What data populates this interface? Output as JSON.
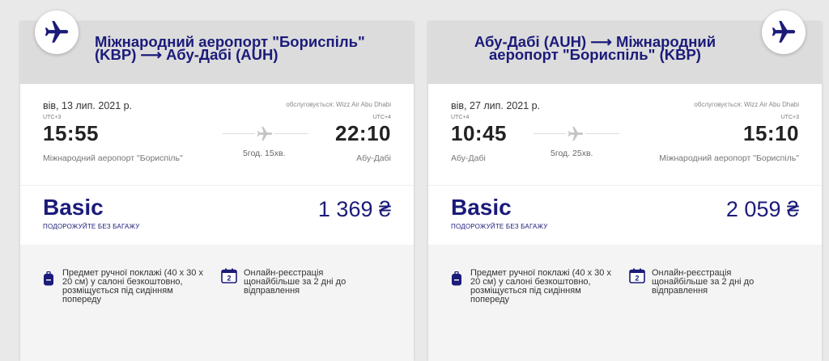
{
  "cards": [
    {
      "route_title": "Міжнародний аеропорт \"Бориспіль\" (KBP) ⟶ Абу-Дабі (AUH)",
      "date": "вів, 13 лип. 2021 р.",
      "operator": "обслуговується: Wizz Air Abu Dhabi",
      "dep_utc": "UTC+3",
      "dep_time": "15:55",
      "dep_airport": "Міжнародний аеропорт \"Бориспіль\"",
      "arr_utc": "UTC+4",
      "arr_time": "22:10",
      "arr_airport": "Абу-Дабі",
      "duration": "5год. 15хв.",
      "fare_name": "Basic",
      "fare_subtitle": "ПОДОРОЖУЙТЕ БЕЗ БАГАЖУ",
      "price": "1 369 ₴",
      "feature_bag": "Предмет ручної поклажі (40 x 30 x 20 см) у салоні безкоштовно, розміщується під сидінням попереду",
      "feature_checkin": "Онлайн-реєстрація щонайбільше за 2 дні до відправлення",
      "checkin_icon_number": "2"
    },
    {
      "route_title": "Абу-Дабі (AUH) ⟶ Міжнародний аеропорт \"Бориспіль\" (KBP)",
      "date": "вів, 27 лип. 2021 р.",
      "operator": "обслуговується: Wizz Air Abu Dhabi",
      "dep_utc": "UTC+4",
      "dep_time": "10:45",
      "dep_airport": "Абу-Дабі",
      "arr_utc": "UTC+3",
      "arr_time": "15:10",
      "arr_airport": "Міжнародний аеропорт \"Бориспіль\"",
      "duration": "5год. 25хв.",
      "fare_name": "Basic",
      "fare_subtitle": "ПОДОРОЖУЙТЕ БЕЗ БАГАЖУ",
      "price": "2 059 ₴",
      "feature_bag": "Предмет ручної поклажі (40 x 30 x 20 см) у салоні безкоштовно, розміщується під сидінням попереду",
      "feature_checkin": "Онлайн-реєстрація щонайбільше за 2 дні до відправлення",
      "checkin_icon_number": "2"
    }
  ],
  "icons": {
    "badge": "airplane-icon",
    "route": "airplane-icon",
    "bag": "backpack-icon",
    "checkin": "calendar-icon"
  },
  "colors": {
    "brand": "#1b1b7a",
    "header_bg": "#dcdcdc",
    "page_bg": "#e9e9e9"
  }
}
